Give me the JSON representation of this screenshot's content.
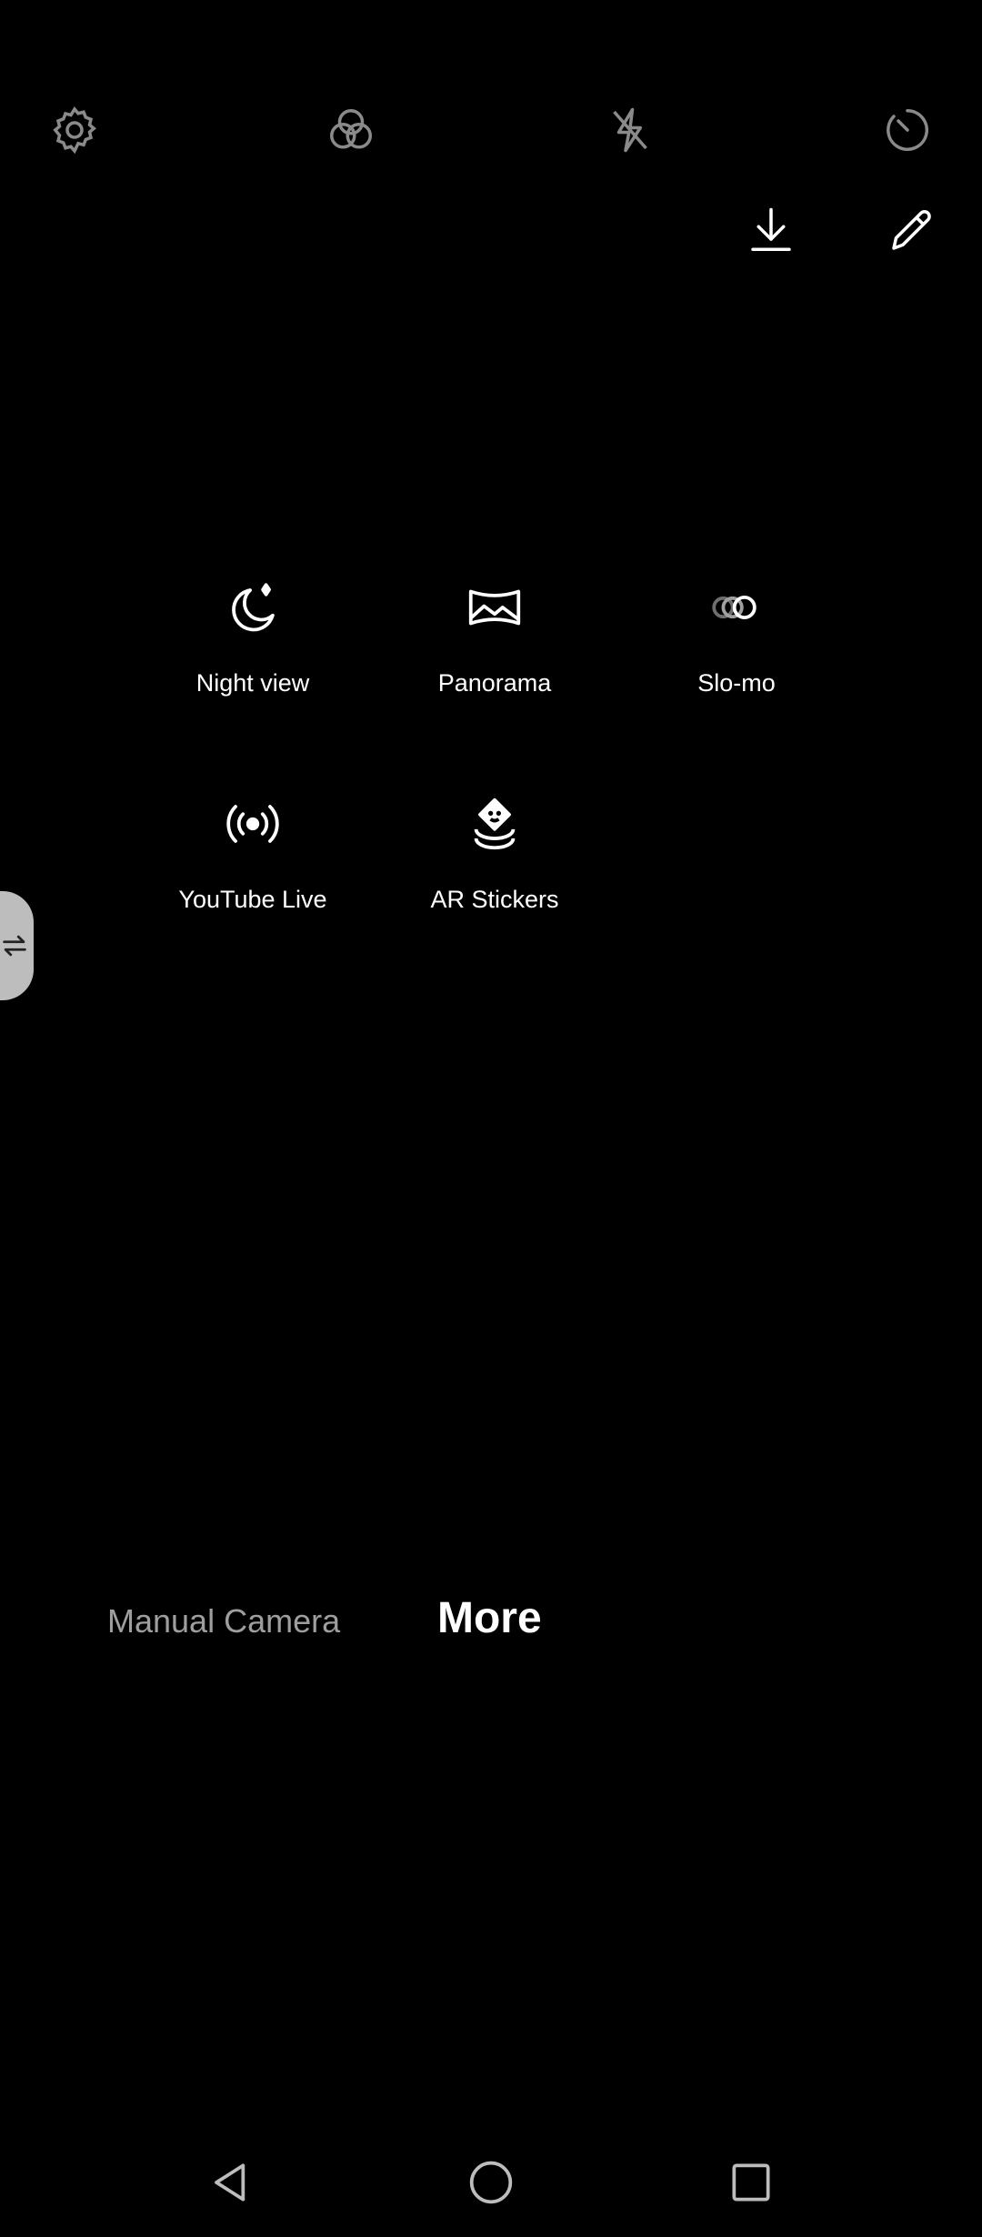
{
  "top_bar": {
    "icons": [
      {
        "name": "settings-icon"
      },
      {
        "name": "filters-icon"
      },
      {
        "name": "flash-off-icon"
      },
      {
        "name": "timer-icon"
      }
    ],
    "secondary_icons": [
      {
        "name": "download-icon"
      },
      {
        "name": "edit-icon"
      }
    ]
  },
  "modes": [
    {
      "label": "Night view",
      "icon": "night-view-icon"
    },
    {
      "label": "Panorama",
      "icon": "panorama-icon"
    },
    {
      "label": "Slo-mo",
      "icon": "slo-mo-icon"
    },
    {
      "label": "YouTube Live",
      "icon": "youtube-live-icon"
    },
    {
      "label": "AR Stickers",
      "icon": "ar-stickers-icon"
    }
  ],
  "mode_switcher": {
    "manual_camera": "Manual Camera",
    "more": "More"
  },
  "colors": {
    "background": "#000000",
    "active_text": "#ffffff",
    "inactive_text": "#9e9e9e",
    "handle": "#bdbdbd"
  }
}
